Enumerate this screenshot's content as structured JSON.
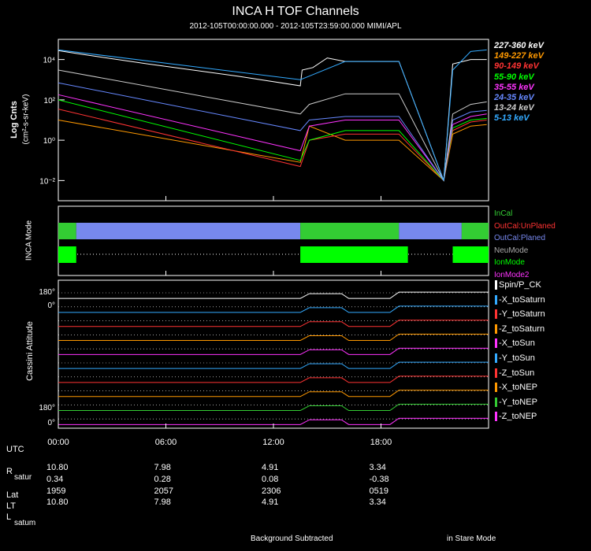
{
  "chart_data": {
    "type": "line",
    "title": "INCA H TOF Channels",
    "subtitle": "2012-105T00:00:00.000 - 2012-105T23:59:00.000 MIMI/APL",
    "panels": [
      {
        "name": "tof",
        "ylabel_main": "Log Cnts",
        "ylabel_units": "(cm²-s-sr-keV)",
        "yscale": "log",
        "ylim": [
          0.001,
          100000
        ],
        "yticks": [
          "10⁴",
          "10²",
          "10⁰",
          "10⁻²"
        ],
        "series": [
          {
            "name": "227-360 keV",
            "color": "#ffffff",
            "points": [
              [
                0,
                28000
              ],
              [
                1,
                20000
              ],
              [
                5,
                6000
              ],
              [
                10,
                1500
              ],
              [
                13.5,
                500
              ],
              [
                13.6,
                3000
              ],
              [
                14.2,
                4000
              ],
              [
                15,
                12000
              ],
              [
                16,
                8000
              ],
              [
                17,
                8000
              ],
              [
                19,
                8000
              ],
              [
                21.5,
                0.01
              ],
              [
                22,
                6000
              ],
              [
                23,
                10000
              ],
              [
                23.9,
                10000
              ]
            ]
          },
          {
            "name": "149-227 keV",
            "color": "#ff9900",
            "points": [
              [
                0,
                10
              ],
              [
                13.5,
                0.08
              ],
              [
                14,
                5
              ],
              [
                16,
                1
              ],
              [
                19,
                1
              ],
              [
                21.5,
                0.01
              ],
              [
                22,
                2
              ],
              [
                23,
                5
              ],
              [
                23.9,
                6
              ]
            ]
          },
          {
            "name": "90-149 keV",
            "color": "#ff3333",
            "points": [
              [
                0,
                35
              ],
              [
                13.5,
                0.05
              ],
              [
                14,
                1
              ],
              [
                16,
                2
              ],
              [
                19,
                2
              ],
              [
                21.5,
                0.01
              ],
              [
                22,
                3
              ],
              [
                23,
                8
              ],
              [
                23.9,
                10
              ]
            ]
          },
          {
            "name": "55-90 keV",
            "color": "#00ff00",
            "points": [
              [
                0,
                100
              ],
              [
                13.5,
                0.1
              ],
              [
                14,
                1
              ],
              [
                16,
                3
              ],
              [
                19,
                3
              ],
              [
                21.5,
                0.01
              ],
              [
                22,
                4
              ],
              [
                23,
                10
              ],
              [
                23.9,
                12
              ]
            ]
          },
          {
            "name": "35-55 keV",
            "color": "#ff33ff",
            "points": [
              [
                0,
                180
              ],
              [
                13.5,
                0.3
              ],
              [
                14,
                5
              ],
              [
                16,
                10
              ],
              [
                19,
                10
              ],
              [
                21.5,
                0.01
              ],
              [
                22,
                6
              ],
              [
                23,
                15
              ],
              [
                23.9,
                20
              ]
            ]
          },
          {
            "name": "24-35 keV",
            "color": "#6688ff",
            "points": [
              [
                0,
                700
              ],
              [
                13.5,
                3
              ],
              [
                14,
                10
              ],
              [
                16,
                15
              ],
              [
                19,
                15
              ],
              [
                21.5,
                0.01
              ],
              [
                22,
                10
              ],
              [
                23,
                25
              ],
              [
                23.9,
                30
              ]
            ]
          },
          {
            "name": "13-24 keV",
            "color": "#cccccc",
            "points": [
              [
                0,
                3000
              ],
              [
                13.5,
                20
              ],
              [
                14,
                60
              ],
              [
                16,
                200
              ],
              [
                19,
                200
              ],
              [
                21.5,
                0.01
              ],
              [
                22,
                20
              ],
              [
                23,
                60
              ],
              [
                23.9,
                80
              ]
            ]
          },
          {
            "name": "5-13 keV",
            "color": "#33aaff",
            "points": [
              [
                0,
                30000
              ],
              [
                13.5,
                1000
              ],
              [
                14,
                1500
              ],
              [
                16,
                8000
              ],
              [
                19,
                8000
              ],
              [
                21.5,
                0.01
              ],
              [
                22,
                3000
              ],
              [
                23,
                25000
              ],
              [
                23.9,
                30000
              ]
            ]
          }
        ]
      },
      {
        "name": "mode",
        "ylabel": "INCA Mode",
        "legend": [
          {
            "name": "InCal",
            "color": "#33cc33"
          },
          {
            "name": "OutCal:UnPlaned",
            "color": "#ff3333"
          },
          {
            "name": "OutCal:Planed",
            "color": "#7788ee"
          },
          {
            "name": "NeuMode",
            "color": "#aaaaaa"
          },
          {
            "name": "IonMode",
            "color": "#00ff00"
          },
          {
            "name": "IonMode2",
            "color": "#ff33ff"
          }
        ],
        "cal_segments": [
          {
            "start": 0,
            "end": 1.0,
            "state": "InCal"
          },
          {
            "start": 1.0,
            "end": 13.5,
            "state": "OutCal:Planed"
          },
          {
            "start": 13.5,
            "end": 19.0,
            "state": "InCal"
          },
          {
            "start": 19.0,
            "end": 22.5,
            "state": "OutCal:Planed"
          },
          {
            "start": 22.5,
            "end": 24,
            "state": "InCal"
          }
        ],
        "ion_segments": [
          {
            "start": 0,
            "end": 1.0
          },
          {
            "start": 13.5,
            "end": 19.5
          },
          {
            "start": 22.0,
            "end": 24
          }
        ]
      },
      {
        "name": "attitude",
        "ylabel": "Cassini Attitude",
        "tick_labels": [
          "180°",
          "0°",
          "180°",
          "0°"
        ],
        "series": [
          {
            "name": "Spin/P_CK",
            "color": "#ffffff"
          },
          {
            "name": "-X_toSaturn",
            "color": "#33aaff"
          },
          {
            "name": "-Y_toSaturn",
            "color": "#ff3333"
          },
          {
            "name": "-Z_toSaturn",
            "color": "#ff9900"
          },
          {
            "name": "-X_toSun",
            "color": "#ff33ff"
          },
          {
            "name": "-Y_toSun",
            "color": "#33aaff"
          },
          {
            "name": "-Z_toSun",
            "color": "#ff3333"
          },
          {
            "name": "-X_toNEP",
            "color": "#ff9900"
          },
          {
            "name": "-Y_toNEP",
            "color": "#33cc33"
          },
          {
            "name": "-Z_toNEP",
            "color": "#ff33ff"
          }
        ]
      }
    ],
    "x_tick_labels": [
      "00:00",
      "06:00",
      "12:00",
      "18:00"
    ],
    "xlim_hours": [
      0,
      24
    ]
  },
  "ephemeris": {
    "utc_label": "UTC",
    "rows": [
      {
        "label": "R",
        "sub": "satur",
        "values": [
          "10.80",
          "7.98",
          "4.91",
          "3.34"
        ]
      },
      {
        "label": "",
        "sub": "",
        "values": [
          "0.34",
          "0.28",
          "0.08",
          "-0.38"
        ]
      },
      {
        "label": "Lat",
        "sub": "",
        "values": [
          "1959",
          "2057",
          "2306",
          "0519"
        ]
      },
      {
        "label": "LT",
        "sub": "",
        "values": [
          "10.80",
          "7.98",
          "4.91",
          "3.34"
        ]
      },
      {
        "label": "L",
        "sub": "satum",
        "values": [],
        "value_row_index": 3
      }
    ]
  },
  "footer": {
    "left": "Background Subtracted",
    "right": "in Stare Mode"
  }
}
